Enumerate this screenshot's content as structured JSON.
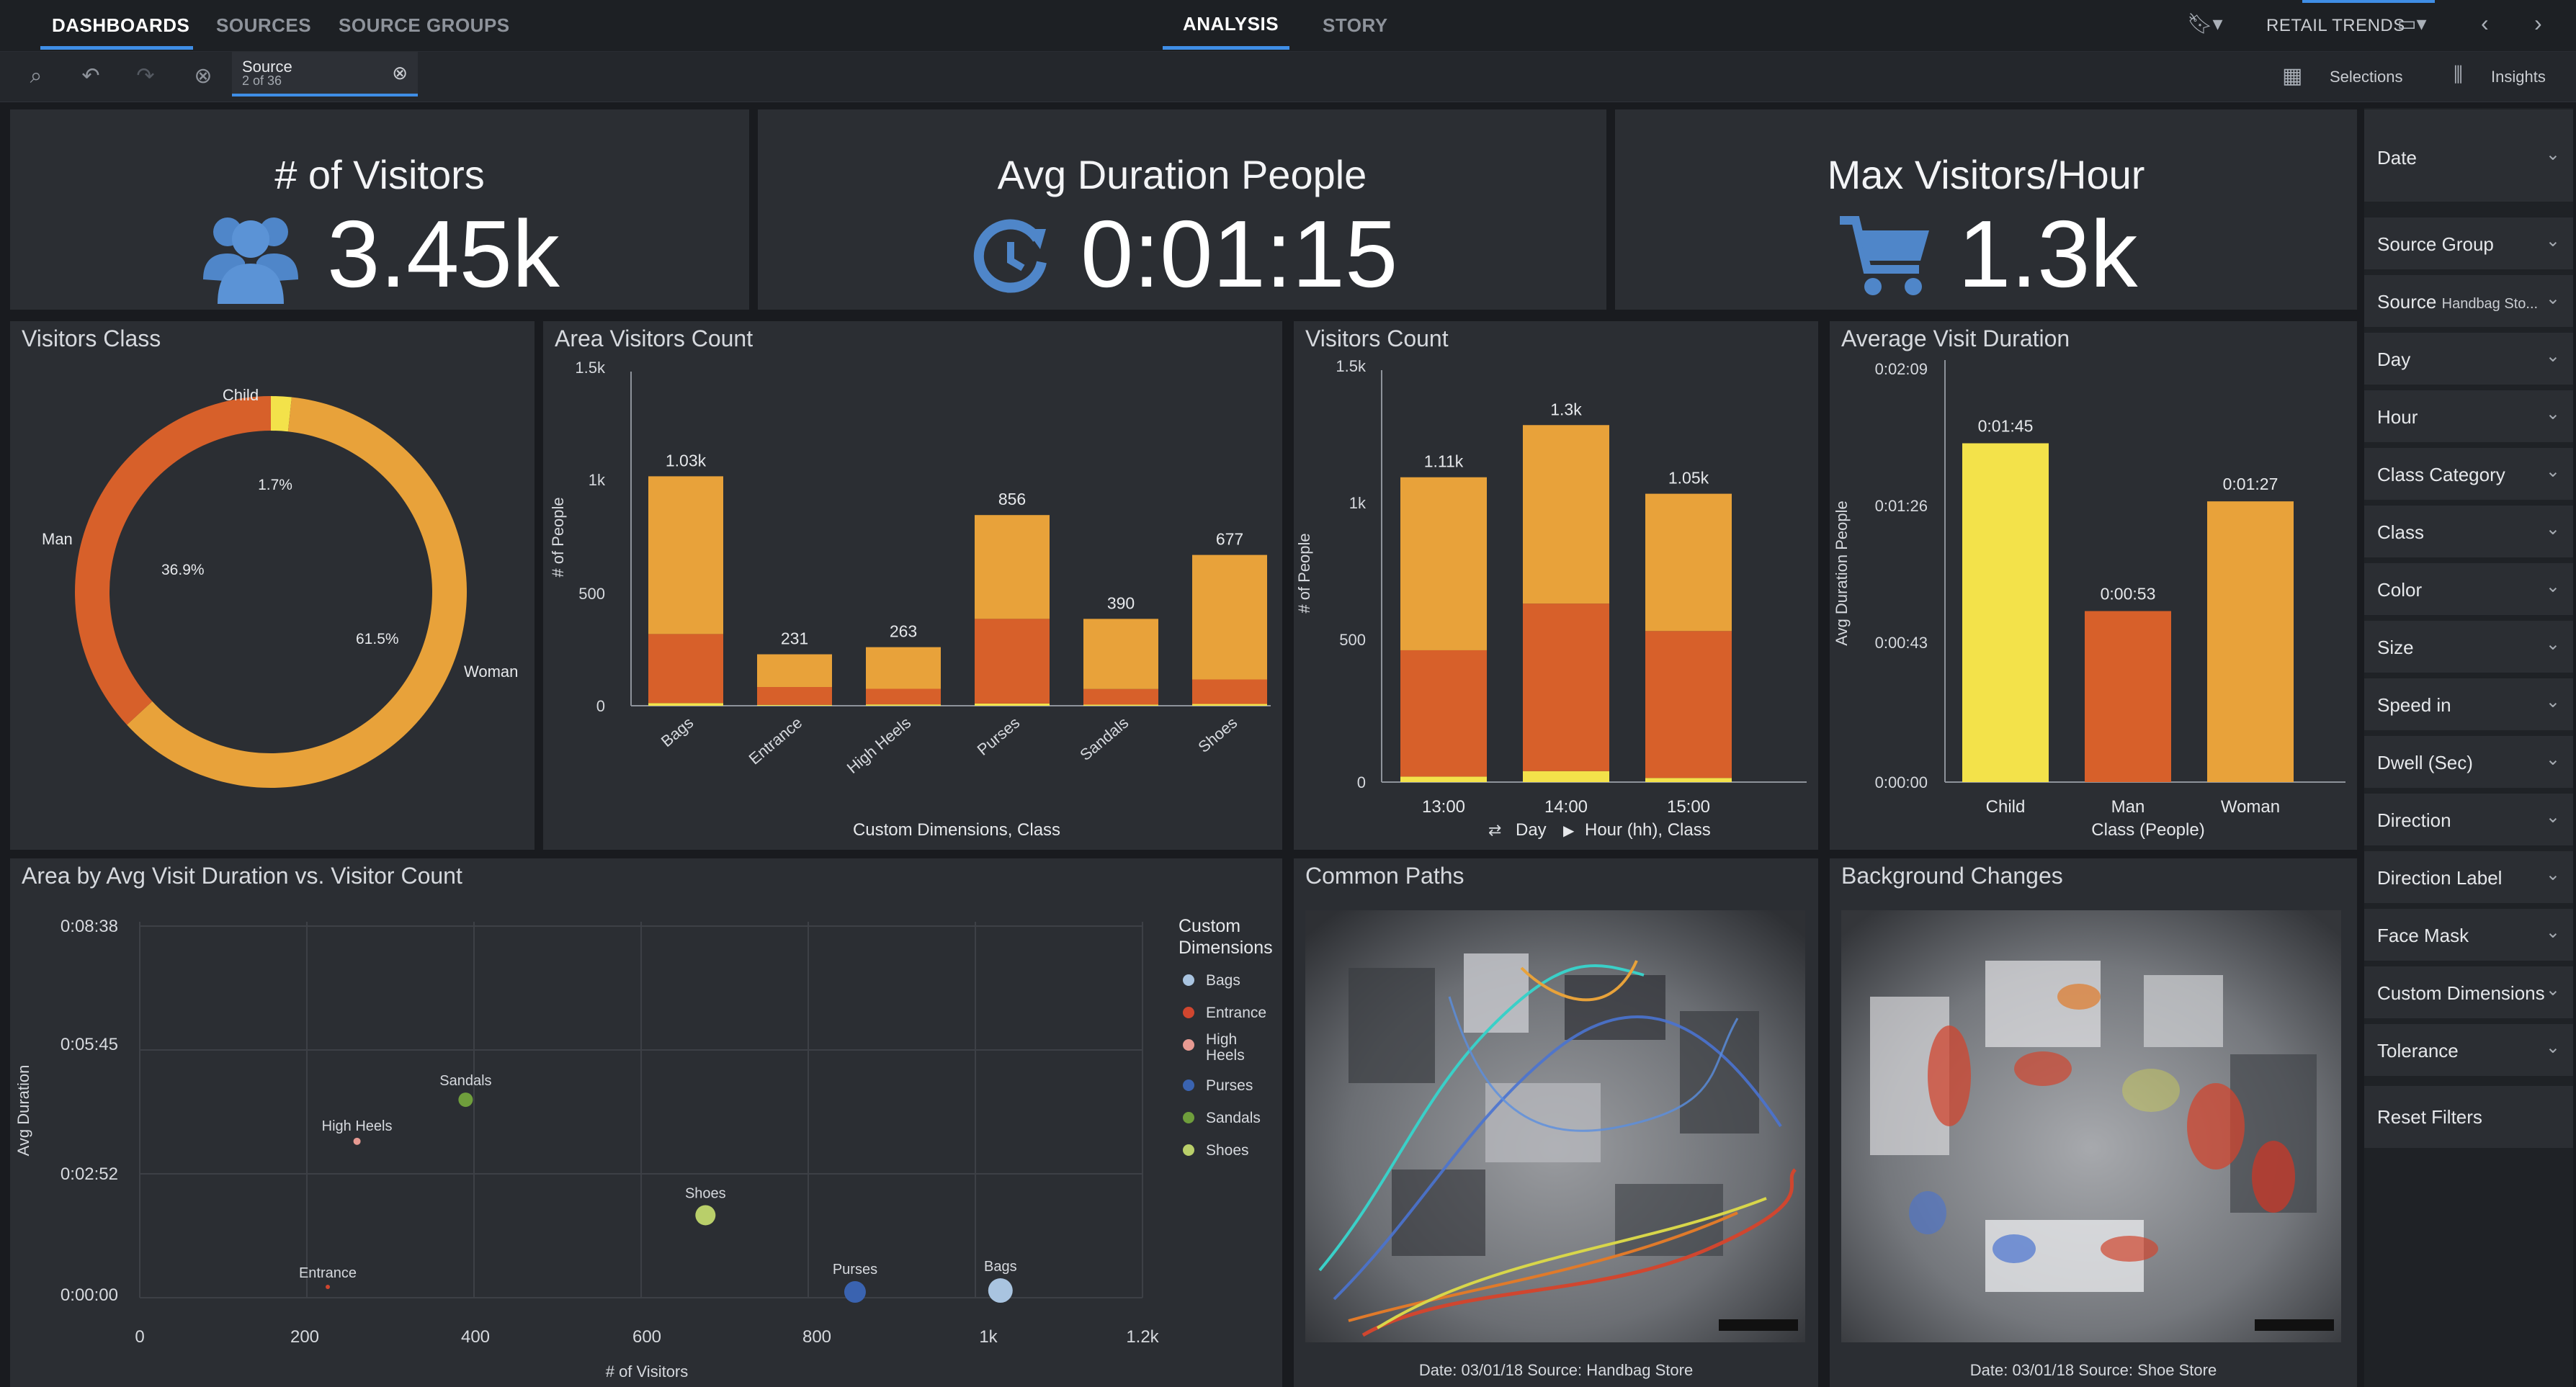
{
  "top_nav": {
    "tabs": [
      "DASHBOARDS",
      "SOURCES",
      "SOURCE GROUPS"
    ],
    "center_tabs": [
      "ANALYSIS",
      "STORY"
    ],
    "dashboard_name": "RETAIL TRENDS"
  },
  "toolbar": {
    "source_label": "Source",
    "source_count": "2 of 36",
    "selections_label": "Selections",
    "insights_label": "Insights"
  },
  "kpis": [
    {
      "title": "# of Visitors",
      "value": "3.45k",
      "icon": "people-icon"
    },
    {
      "title": "Avg Duration People",
      "value": "0:01:15",
      "icon": "clock-icon"
    },
    {
      "title": "Max Visitors/Hour",
      "value": "1.3k",
      "icon": "cart-icon"
    }
  ],
  "colors": {
    "yellow": "#f3e24a",
    "orange": "#e8a23a",
    "red_orange": "#d7602a",
    "accent_blue": "#3f8ee6"
  },
  "visitors_class": {
    "title": "Visitors Class",
    "labels": {
      "child": "Child",
      "man": "Man",
      "woman": "Woman"
    },
    "pct": {
      "child": "1.7%",
      "man": "36.9%",
      "woman": "61.5%"
    }
  },
  "area_visitors": {
    "title": "Area Visitors Count",
    "y_label": "# of People",
    "x_label": "Custom Dimensions, Class",
    "y_ticks": [
      "1.5k",
      "1k",
      "500",
      "0"
    ],
    "data_labels": [
      "1.03k",
      "231",
      "263",
      "856",
      "390",
      "677"
    ]
  },
  "visitors_count": {
    "title": "Visitors Count",
    "y_label": "# of People",
    "x_label_day": "Day",
    "x_label_rest": "Hour (hh), Class",
    "y_ticks": [
      "1.5k",
      "1k",
      "500",
      "0"
    ],
    "data_labels": [
      "1.11k",
      "1.3k",
      "1.05k"
    ]
  },
  "avg_duration": {
    "title": "Average Visit Duration",
    "y_label": "Avg Duration People",
    "x_label": "Class (People)",
    "y_ticks": [
      "0:02:09",
      "0:01:26",
      "0:00:43",
      "0:00:00"
    ],
    "data_labels": [
      "0:01:45",
      "0:00:53",
      "0:01:27"
    ]
  },
  "scatter": {
    "title": "Area by Avg Visit Duration vs. Visitor Count",
    "y_label": "Avg Duration",
    "x_label": "# of Visitors",
    "y_ticks": [
      "0:08:38",
      "0:05:45",
      "0:02:52",
      "0:00:00"
    ],
    "x_ticks": [
      "0",
      "200",
      "400",
      "600",
      "800",
      "1k",
      "1.2k"
    ],
    "legend_title_1": "Custom",
    "legend_title_2": "Dimensions",
    "legend": [
      {
        "name": "Bags",
        "color": "#a9c4e0"
      },
      {
        "name": "Entrance",
        "color": "#d0462f"
      },
      {
        "name": "High Heels",
        "color": "#e79a92"
      },
      {
        "name": "Purses",
        "color": "#3a63b0"
      },
      {
        "name": "Sandals",
        "color": "#6f9e3c"
      },
      {
        "name": "Shoes",
        "color": "#b9cf6a"
      }
    ]
  },
  "common_paths": {
    "title": "Common Paths",
    "caption": "Date: 03/01/18 Source: Handbag Store"
  },
  "background_changes": {
    "title": "Background Changes",
    "caption": "Date: 03/01/18 Source: Shoe Store"
  },
  "filters": {
    "date": "Date",
    "source_group": "Source Group",
    "source": "Source",
    "source_value": "Handbag Sto...",
    "items": [
      "Day",
      "Hour",
      "Class Category",
      "Class",
      "Color",
      "Size",
      "Speed in",
      "Dwell (Sec)",
      "Direction",
      "Direction Label",
      "Face Mask",
      "Custom Dimensions",
      "Tolerance"
    ],
    "reset": "Reset Filters"
  },
  "chart_data": [
    {
      "type": "pie",
      "title": "Visitors Class",
      "categories": [
        "Child",
        "Man",
        "Woman"
      ],
      "values": [
        1.7,
        36.9,
        61.5
      ]
    },
    {
      "type": "bar",
      "title": "Area Visitors Count",
      "categories": [
        "Bags",
        "Entrance",
        "High Heels",
        "Purses",
        "Sandals",
        "Shoes"
      ],
      "totals": [
        1030,
        231,
        263,
        856,
        390,
        677
      ],
      "series": [
        {
          "name": "Child",
          "values": [
            12,
            4,
            6,
            10,
            5,
            8
          ]
        },
        {
          "name": "Man",
          "values": [
            310,
            80,
            70,
            380,
            70,
            110
          ]
        },
        {
          "name": "Woman",
          "values": [
            708,
            147,
            187,
            466,
            315,
            559
          ]
        }
      ],
      "xlabel": "Custom Dimensions, Class",
      "ylabel": "# of People",
      "ylim": [
        0,
        1500
      ]
    },
    {
      "type": "bar",
      "title": "Visitors Count",
      "categories": [
        "13:00",
        "14:00",
        "15:00"
      ],
      "totals": [
        1110,
        1300,
        1050
      ],
      "series": [
        {
          "name": "Child",
          "values": [
            20,
            40,
            15
          ]
        },
        {
          "name": "Man",
          "values": [
            460,
            610,
            535
          ]
        },
        {
          "name": "Woman",
          "values": [
            630,
            650,
            500
          ]
        }
      ],
      "xlabel": "Day, Hour (hh), Class",
      "ylabel": "# of People",
      "ylim": [
        0,
        1500
      ]
    },
    {
      "type": "bar",
      "title": "Average Visit Duration",
      "categories": [
        "Child",
        "Man",
        "Woman"
      ],
      "values": [
        105,
        53,
        87
      ],
      "xlabel": "Class (People)",
      "ylabel": "Avg Duration People",
      "ylim": [
        0,
        129
      ]
    },
    {
      "type": "scatter",
      "title": "Area by Avg Visit Duration vs. Visitor Count",
      "series": [
        {
          "name": "Bags",
          "x": 1030,
          "y": 10
        },
        {
          "name": "Entrance",
          "x": 225,
          "y": 15
        },
        {
          "name": "High Heels",
          "x": 260,
          "y": 218
        },
        {
          "name": "Purses",
          "x": 856,
          "y": 8
        },
        {
          "name": "Sandals",
          "x": 390,
          "y": 276
        },
        {
          "name": "Shoes",
          "x": 677,
          "y": 115
        }
      ],
      "xlabel": "# of Visitors",
      "ylabel": "Avg Duration",
      "xlim": [
        0,
        1200
      ],
      "ylim": [
        0,
        518
      ]
    }
  ]
}
